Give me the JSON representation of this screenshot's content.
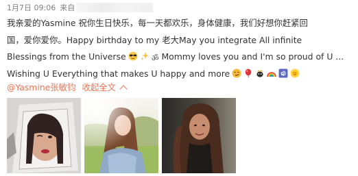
{
  "post": {
    "date": "1月7日",
    "time": "09:06",
    "source_prefix": "来自",
    "lines": [
      {
        "text": "我亲爱的Yasmine 祝你生日快乐，每一天都欢乐，身体健康，我们好想你赶紧回"
      },
      {
        "text": "国，爱你爱你。Happy birthday to my 老大May you integrate All infinite"
      },
      {
        "text": "Blessings from the Universe",
        "emoji": [
          "sunglasses-face",
          "sparkles",
          "om-symbol"
        ],
        "after": " Mommy loves you and I'm so proud of U ..."
      },
      {
        "text": "Wishing U Everything that makes U happy and more",
        "emoji": [
          "smirking-face",
          "balloon",
          "crown-bug",
          "rainbow",
          "cyclone",
          "sun-with-face"
        ]
      }
    ]
  },
  "actions": {
    "mention": "@Yasmine张敏钧",
    "collapse": "收起全文"
  },
  "photos": [
    {
      "name": "photo-winking-girl"
    },
    {
      "name": "photo-girl-in-park"
    },
    {
      "name": "photo-woman-portrait"
    }
  ],
  "colors": {
    "link": "#eb7350",
    "text": "#333333",
    "meta": "#808080"
  }
}
